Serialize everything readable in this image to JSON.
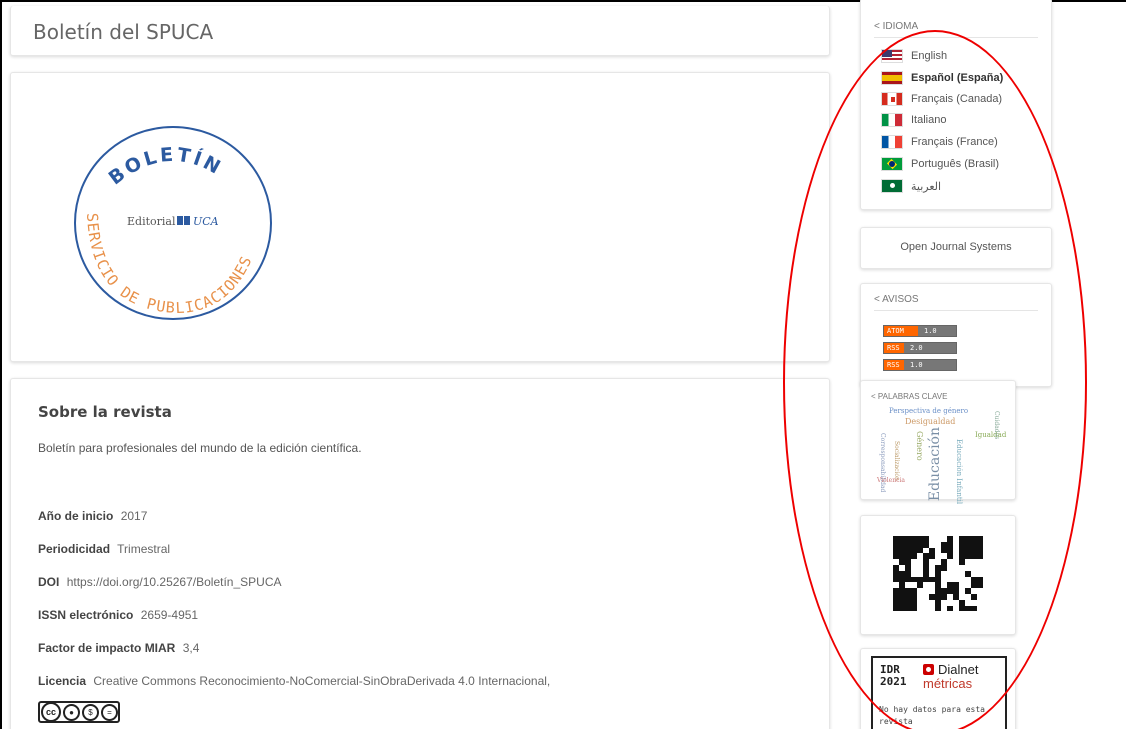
{
  "header": {
    "site_title": "Boletín del SPUCA"
  },
  "logo": {
    "top_text": "BOLETÍN",
    "center_text": "Editorial",
    "center_brand": "UCA",
    "arc_right": "SERVICIO DE PUBLICACIONES",
    "ring_color": "#2c5aa0",
    "text_color": "#e8914a"
  },
  "about": {
    "title": "Sobre la revista",
    "description": "Boletín para profesionales del mundo de la edición científica.",
    "rows": [
      {
        "label": "Año de inicio",
        "value": "2017"
      },
      {
        "label": "Periodicidad",
        "value": "Trimestral"
      },
      {
        "label": "DOI",
        "value": "https://doi.org/10.25267/Boletín_SPUCA"
      },
      {
        "label": "ISSN electrónico",
        "value": "2659-4951"
      },
      {
        "label": "Factor de impacto MIAR",
        "value": "3,4"
      },
      {
        "label": "Licencia",
        "value": "Creative Commons Reconocimiento-NoComercial-SinObraDerivada 4.0 Internacional,"
      }
    ],
    "cc_badge_text": "BY NC ND"
  },
  "sidebar": {
    "language": {
      "title": "< IDIOMA",
      "items": [
        {
          "label": "English",
          "flag": "us-flag-icon",
          "active": false
        },
        {
          "label": "Español (España)",
          "flag": "es-flag-icon",
          "active": true
        },
        {
          "label": "Français (Canada)",
          "flag": "ca-flag-icon",
          "active": false
        },
        {
          "label": "Italiano",
          "flag": "it-flag-icon",
          "active": false
        },
        {
          "label": "Français (France)",
          "flag": "fr-flag-icon",
          "active": false
        },
        {
          "label": "Português (Brasil)",
          "flag": "br-flag-icon",
          "active": false
        },
        {
          "label": "العربية",
          "flag": "sa-flag-icon",
          "active": false
        }
      ]
    },
    "ojs": {
      "label": "Open Journal Systems"
    },
    "avisos": {
      "title": "< AVISOS",
      "feeds": [
        {
          "type": "ATOM",
          "version": "1.0"
        },
        {
          "type": "RSS",
          "version": "2.0"
        },
        {
          "type": "RSS",
          "version": "1.0"
        }
      ]
    },
    "keywords": {
      "title": "< PALABRAS CLAVE",
      "words": [
        "Perspectiva de género",
        "Desigualdad",
        "Educación",
        "Igualdad",
        "Género",
        "Corresponsabilidad",
        "Socialización",
        "Educación Infantil",
        "Cuidados",
        "Violencia"
      ]
    },
    "dialnet": {
      "idr_line1": "IDR",
      "idr_line2": "2021",
      "brand": "Dialnet",
      "brand_sub": "métricas",
      "no_data": "No hay datos para esta revista"
    }
  }
}
